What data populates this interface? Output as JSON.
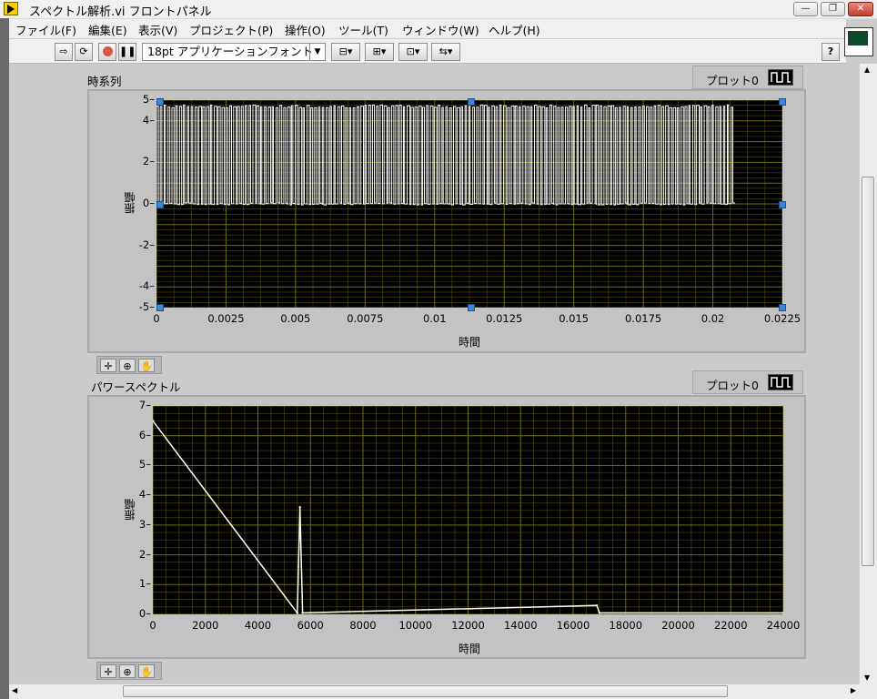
{
  "window": {
    "title": "スペクトル解析.vi フロントパネル",
    "controls": {
      "minimize": "—",
      "restore": "❐",
      "close": "✕"
    }
  },
  "menu": [
    "ファイル(F)",
    "編集(E)",
    "表示(V)",
    "プロジェクト(P)",
    "操作(O)",
    "ツール(T)",
    "ウィンドウ(W)",
    "ヘルプ(H)"
  ],
  "toolbar": {
    "run_icon": "run-arrow-icon",
    "font_select": "18pt アプリケーションフォント",
    "help_label": "?"
  },
  "graphs": [
    {
      "label": "時系列",
      "legend_label": "プロット0",
      "xlabel": "時間",
      "ylabel": "振幅",
      "xticks": [
        "0",
        "0.0025",
        "0.005",
        "0.0075",
        "0.01",
        "0.0125",
        "0.015",
        "0.0175",
        "0.02",
        "0.0225"
      ],
      "yticks": [
        "5",
        "4",
        "2",
        "0",
        "-2",
        "-4",
        "-5"
      ]
    },
    {
      "label": "パワースペクトル",
      "legend_label": "プロット0",
      "xlabel": "時間",
      "ylabel": "振幅",
      "xticks": [
        "0",
        "2000",
        "4000",
        "6000",
        "8000",
        "10000",
        "12000",
        "14000",
        "16000",
        "18000",
        "20000",
        "22000",
        "24000"
      ],
      "yticks": [
        "7",
        "6",
        "5",
        "4",
        "3",
        "2",
        "1",
        "0"
      ]
    }
  ],
  "chart_data": [
    {
      "type": "line",
      "title": "時系列",
      "xlabel": "時間",
      "ylabel": "振幅",
      "xlim": [
        0,
        0.0225
      ],
      "ylim": [
        -5,
        5
      ],
      "grid": true,
      "legend": "top-right",
      "series": [
        {
          "name": "プロット0",
          "shape": "square-wave",
          "high": 4.7,
          "low": 0,
          "x_end": 0.0208,
          "cycles": 150
        }
      ]
    },
    {
      "type": "line",
      "title": "パワースペクトル",
      "xlabel": "時間",
      "ylabel": "振幅",
      "xlim": [
        0,
        24000
      ],
      "ylim": [
        0,
        7
      ],
      "grid": true,
      "legend": "top-right",
      "series": [
        {
          "name": "プロット0",
          "x": [
            0,
            5500,
            5600,
            5700,
            16900,
            17000,
            24000
          ],
          "y": [
            6.5,
            0.05,
            3.6,
            0.05,
            0.3,
            0.05,
            0.05
          ]
        }
      ]
    }
  ],
  "colors": {
    "plot_bg": "#000000",
    "grid": "#6d6d12",
    "trace": "#ffffff",
    "panel": "#c3c3c3",
    "selection": "#3a86d8"
  }
}
